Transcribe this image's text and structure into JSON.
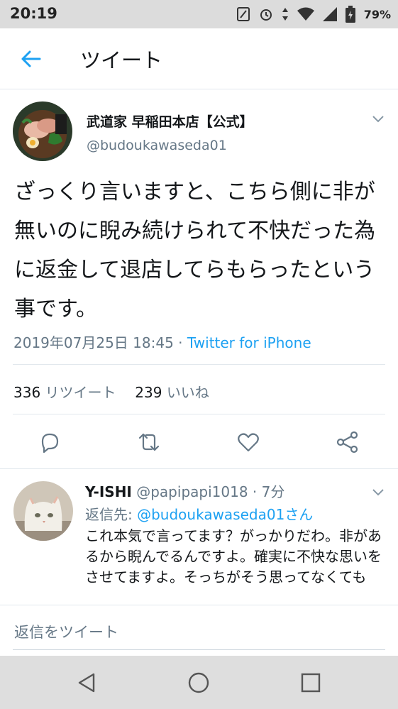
{
  "status_bar": {
    "time": "20:19",
    "battery": "79%"
  },
  "app_bar": {
    "title": "ツイート"
  },
  "tweet": {
    "author_name": "武道家 早稲田本店【公式】",
    "author_handle": "@budoukawaseda01",
    "text": "ざっくり言いますと、こちら側に非が無いのに睨み続けられて不快だった為に返金して退店してらもらったという事です。",
    "timestamp": "2019年07月25日 18:45",
    "separator": " · ",
    "client": "Twitter for iPhone",
    "retweet_count": "336",
    "retweet_label": "リツイート",
    "like_count": "239",
    "like_label": "いいね"
  },
  "reply": {
    "author_name": "Y-ISHI",
    "author_handle": "@papipapi1018",
    "time": "· 7分",
    "reply_to_prefix": "返信先:",
    "reply_to_mention": "@budoukawaseda01さん",
    "text": "これ本気で言ってます？がっかりだわ。非があるから睨んでるんですよ。確実に不快な思いをさせてますよ。そっちがそう思ってなくても"
  },
  "composer": {
    "placeholder": "返信をツイート"
  },
  "colors": {
    "accent": "#1da1f2",
    "secondary_text": "#657786",
    "primary_text": "#14171a",
    "divider": "#e1e8ed"
  },
  "icons": [
    "back-arrow-icon",
    "caret-down-icon",
    "reply-icon",
    "retweet-icon",
    "like-icon",
    "share-icon",
    "nav-back-icon",
    "nav-home-icon",
    "nav-recents-icon"
  ]
}
